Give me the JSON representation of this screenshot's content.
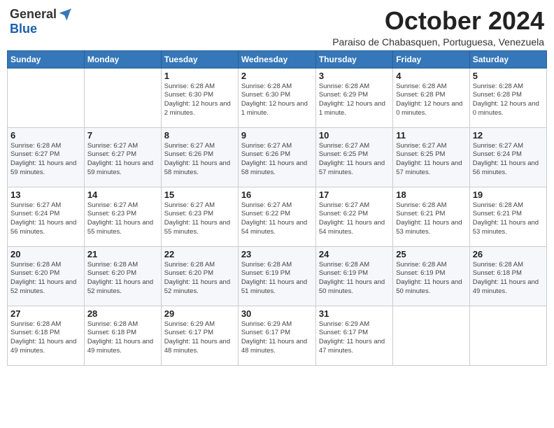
{
  "header": {
    "logo": {
      "general": "General",
      "blue": "Blue"
    },
    "title": "October 2024",
    "location": "Paraiso de Chabasquen, Portuguesa, Venezuela"
  },
  "calendar": {
    "days": [
      "Sunday",
      "Monday",
      "Tuesday",
      "Wednesday",
      "Thursday",
      "Friday",
      "Saturday"
    ],
    "weeks": [
      [
        {
          "day": "",
          "content": ""
        },
        {
          "day": "",
          "content": ""
        },
        {
          "day": "1",
          "content": "Sunrise: 6:28 AM\nSunset: 6:30 PM\nDaylight: 12 hours\nand 2 minutes."
        },
        {
          "day": "2",
          "content": "Sunrise: 6:28 AM\nSunset: 6:30 PM\nDaylight: 12 hours\nand 1 minute."
        },
        {
          "day": "3",
          "content": "Sunrise: 6:28 AM\nSunset: 6:29 PM\nDaylight: 12 hours\nand 1 minute."
        },
        {
          "day": "4",
          "content": "Sunrise: 6:28 AM\nSunset: 6:28 PM\nDaylight: 12 hours\nand 0 minutes."
        },
        {
          "day": "5",
          "content": "Sunrise: 6:28 AM\nSunset: 6:28 PM\nDaylight: 12 hours\nand 0 minutes."
        }
      ],
      [
        {
          "day": "6",
          "content": "Sunrise: 6:28 AM\nSunset: 6:27 PM\nDaylight: 11 hours\nand 59 minutes."
        },
        {
          "day": "7",
          "content": "Sunrise: 6:27 AM\nSunset: 6:27 PM\nDaylight: 11 hours\nand 59 minutes."
        },
        {
          "day": "8",
          "content": "Sunrise: 6:27 AM\nSunset: 6:26 PM\nDaylight: 11 hours\nand 58 minutes."
        },
        {
          "day": "9",
          "content": "Sunrise: 6:27 AM\nSunset: 6:26 PM\nDaylight: 11 hours\nand 58 minutes."
        },
        {
          "day": "10",
          "content": "Sunrise: 6:27 AM\nSunset: 6:25 PM\nDaylight: 11 hours\nand 57 minutes."
        },
        {
          "day": "11",
          "content": "Sunrise: 6:27 AM\nSunset: 6:25 PM\nDaylight: 11 hours\nand 57 minutes."
        },
        {
          "day": "12",
          "content": "Sunrise: 6:27 AM\nSunset: 6:24 PM\nDaylight: 11 hours\nand 56 minutes."
        }
      ],
      [
        {
          "day": "13",
          "content": "Sunrise: 6:27 AM\nSunset: 6:24 PM\nDaylight: 11 hours\nand 56 minutes."
        },
        {
          "day": "14",
          "content": "Sunrise: 6:27 AM\nSunset: 6:23 PM\nDaylight: 11 hours\nand 55 minutes."
        },
        {
          "day": "15",
          "content": "Sunrise: 6:27 AM\nSunset: 6:23 PM\nDaylight: 11 hours\nand 55 minutes."
        },
        {
          "day": "16",
          "content": "Sunrise: 6:27 AM\nSunset: 6:22 PM\nDaylight: 11 hours\nand 54 minutes."
        },
        {
          "day": "17",
          "content": "Sunrise: 6:27 AM\nSunset: 6:22 PM\nDaylight: 11 hours\nand 54 minutes."
        },
        {
          "day": "18",
          "content": "Sunrise: 6:28 AM\nSunset: 6:21 PM\nDaylight: 11 hours\nand 53 minutes."
        },
        {
          "day": "19",
          "content": "Sunrise: 6:28 AM\nSunset: 6:21 PM\nDaylight: 11 hours\nand 53 minutes."
        }
      ],
      [
        {
          "day": "20",
          "content": "Sunrise: 6:28 AM\nSunset: 6:20 PM\nDaylight: 11 hours\nand 52 minutes."
        },
        {
          "day": "21",
          "content": "Sunrise: 6:28 AM\nSunset: 6:20 PM\nDaylight: 11 hours\nand 52 minutes."
        },
        {
          "day": "22",
          "content": "Sunrise: 6:28 AM\nSunset: 6:20 PM\nDaylight: 11 hours\nand 52 minutes."
        },
        {
          "day": "23",
          "content": "Sunrise: 6:28 AM\nSunset: 6:19 PM\nDaylight: 11 hours\nand 51 minutes."
        },
        {
          "day": "24",
          "content": "Sunrise: 6:28 AM\nSunset: 6:19 PM\nDaylight: 11 hours\nand 50 minutes."
        },
        {
          "day": "25",
          "content": "Sunrise: 6:28 AM\nSunset: 6:19 PM\nDaylight: 11 hours\nand 50 minutes."
        },
        {
          "day": "26",
          "content": "Sunrise: 6:28 AM\nSunset: 6:18 PM\nDaylight: 11 hours\nand 49 minutes."
        }
      ],
      [
        {
          "day": "27",
          "content": "Sunrise: 6:28 AM\nSunset: 6:18 PM\nDaylight: 11 hours\nand 49 minutes."
        },
        {
          "day": "28",
          "content": "Sunrise: 6:28 AM\nSunset: 6:18 PM\nDaylight: 11 hours\nand 49 minutes."
        },
        {
          "day": "29",
          "content": "Sunrise: 6:29 AM\nSunset: 6:17 PM\nDaylight: 11 hours\nand 48 minutes."
        },
        {
          "day": "30",
          "content": "Sunrise: 6:29 AM\nSunset: 6:17 PM\nDaylight: 11 hours\nand 48 minutes."
        },
        {
          "day": "31",
          "content": "Sunrise: 6:29 AM\nSunset: 6:17 PM\nDaylight: 11 hours\nand 47 minutes."
        },
        {
          "day": "",
          "content": ""
        },
        {
          "day": "",
          "content": ""
        }
      ]
    ]
  }
}
